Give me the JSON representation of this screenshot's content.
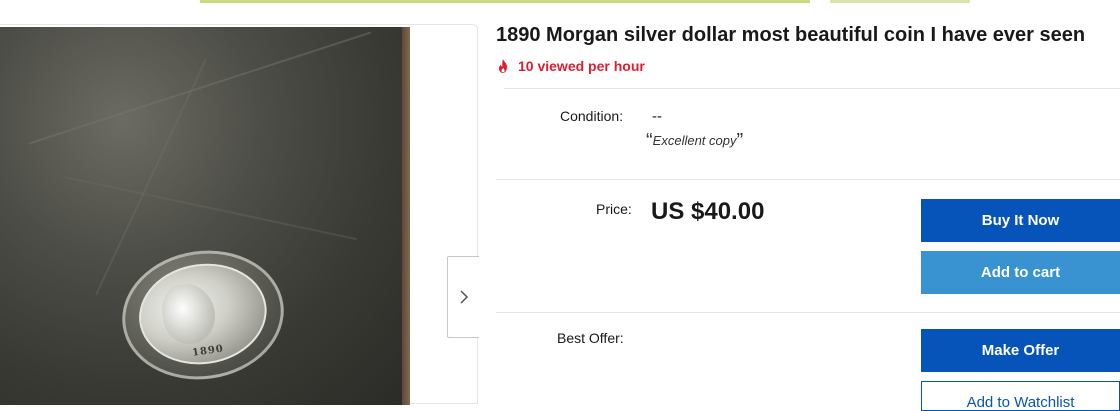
{
  "listing": {
    "title": "1890 Morgan silver dollar most beautiful coin I have ever seen",
    "views_text": "10 viewed per hour",
    "coin_date": "1890"
  },
  "details": {
    "condition_label": "Condition:",
    "condition_value": "--",
    "condition_note_open": "“",
    "condition_note": "Excellent copy",
    "condition_note_close": "”",
    "price_label": "Price:",
    "price_value": "US $40.00",
    "best_offer_label": "Best Offer:"
  },
  "actions": {
    "buy_now": "Buy It Now",
    "add_to_cart": "Add to cart",
    "make_offer": "Make Offer",
    "add_to_watchlist": "Add to Watchlist"
  },
  "icons": {
    "views": "flame-icon",
    "gallery_next": "chevron-right-icon"
  },
  "colors": {
    "primary_button": "#0654ba",
    "secondary_button": "#3a93d1",
    "views_text": "#dd1e31"
  }
}
